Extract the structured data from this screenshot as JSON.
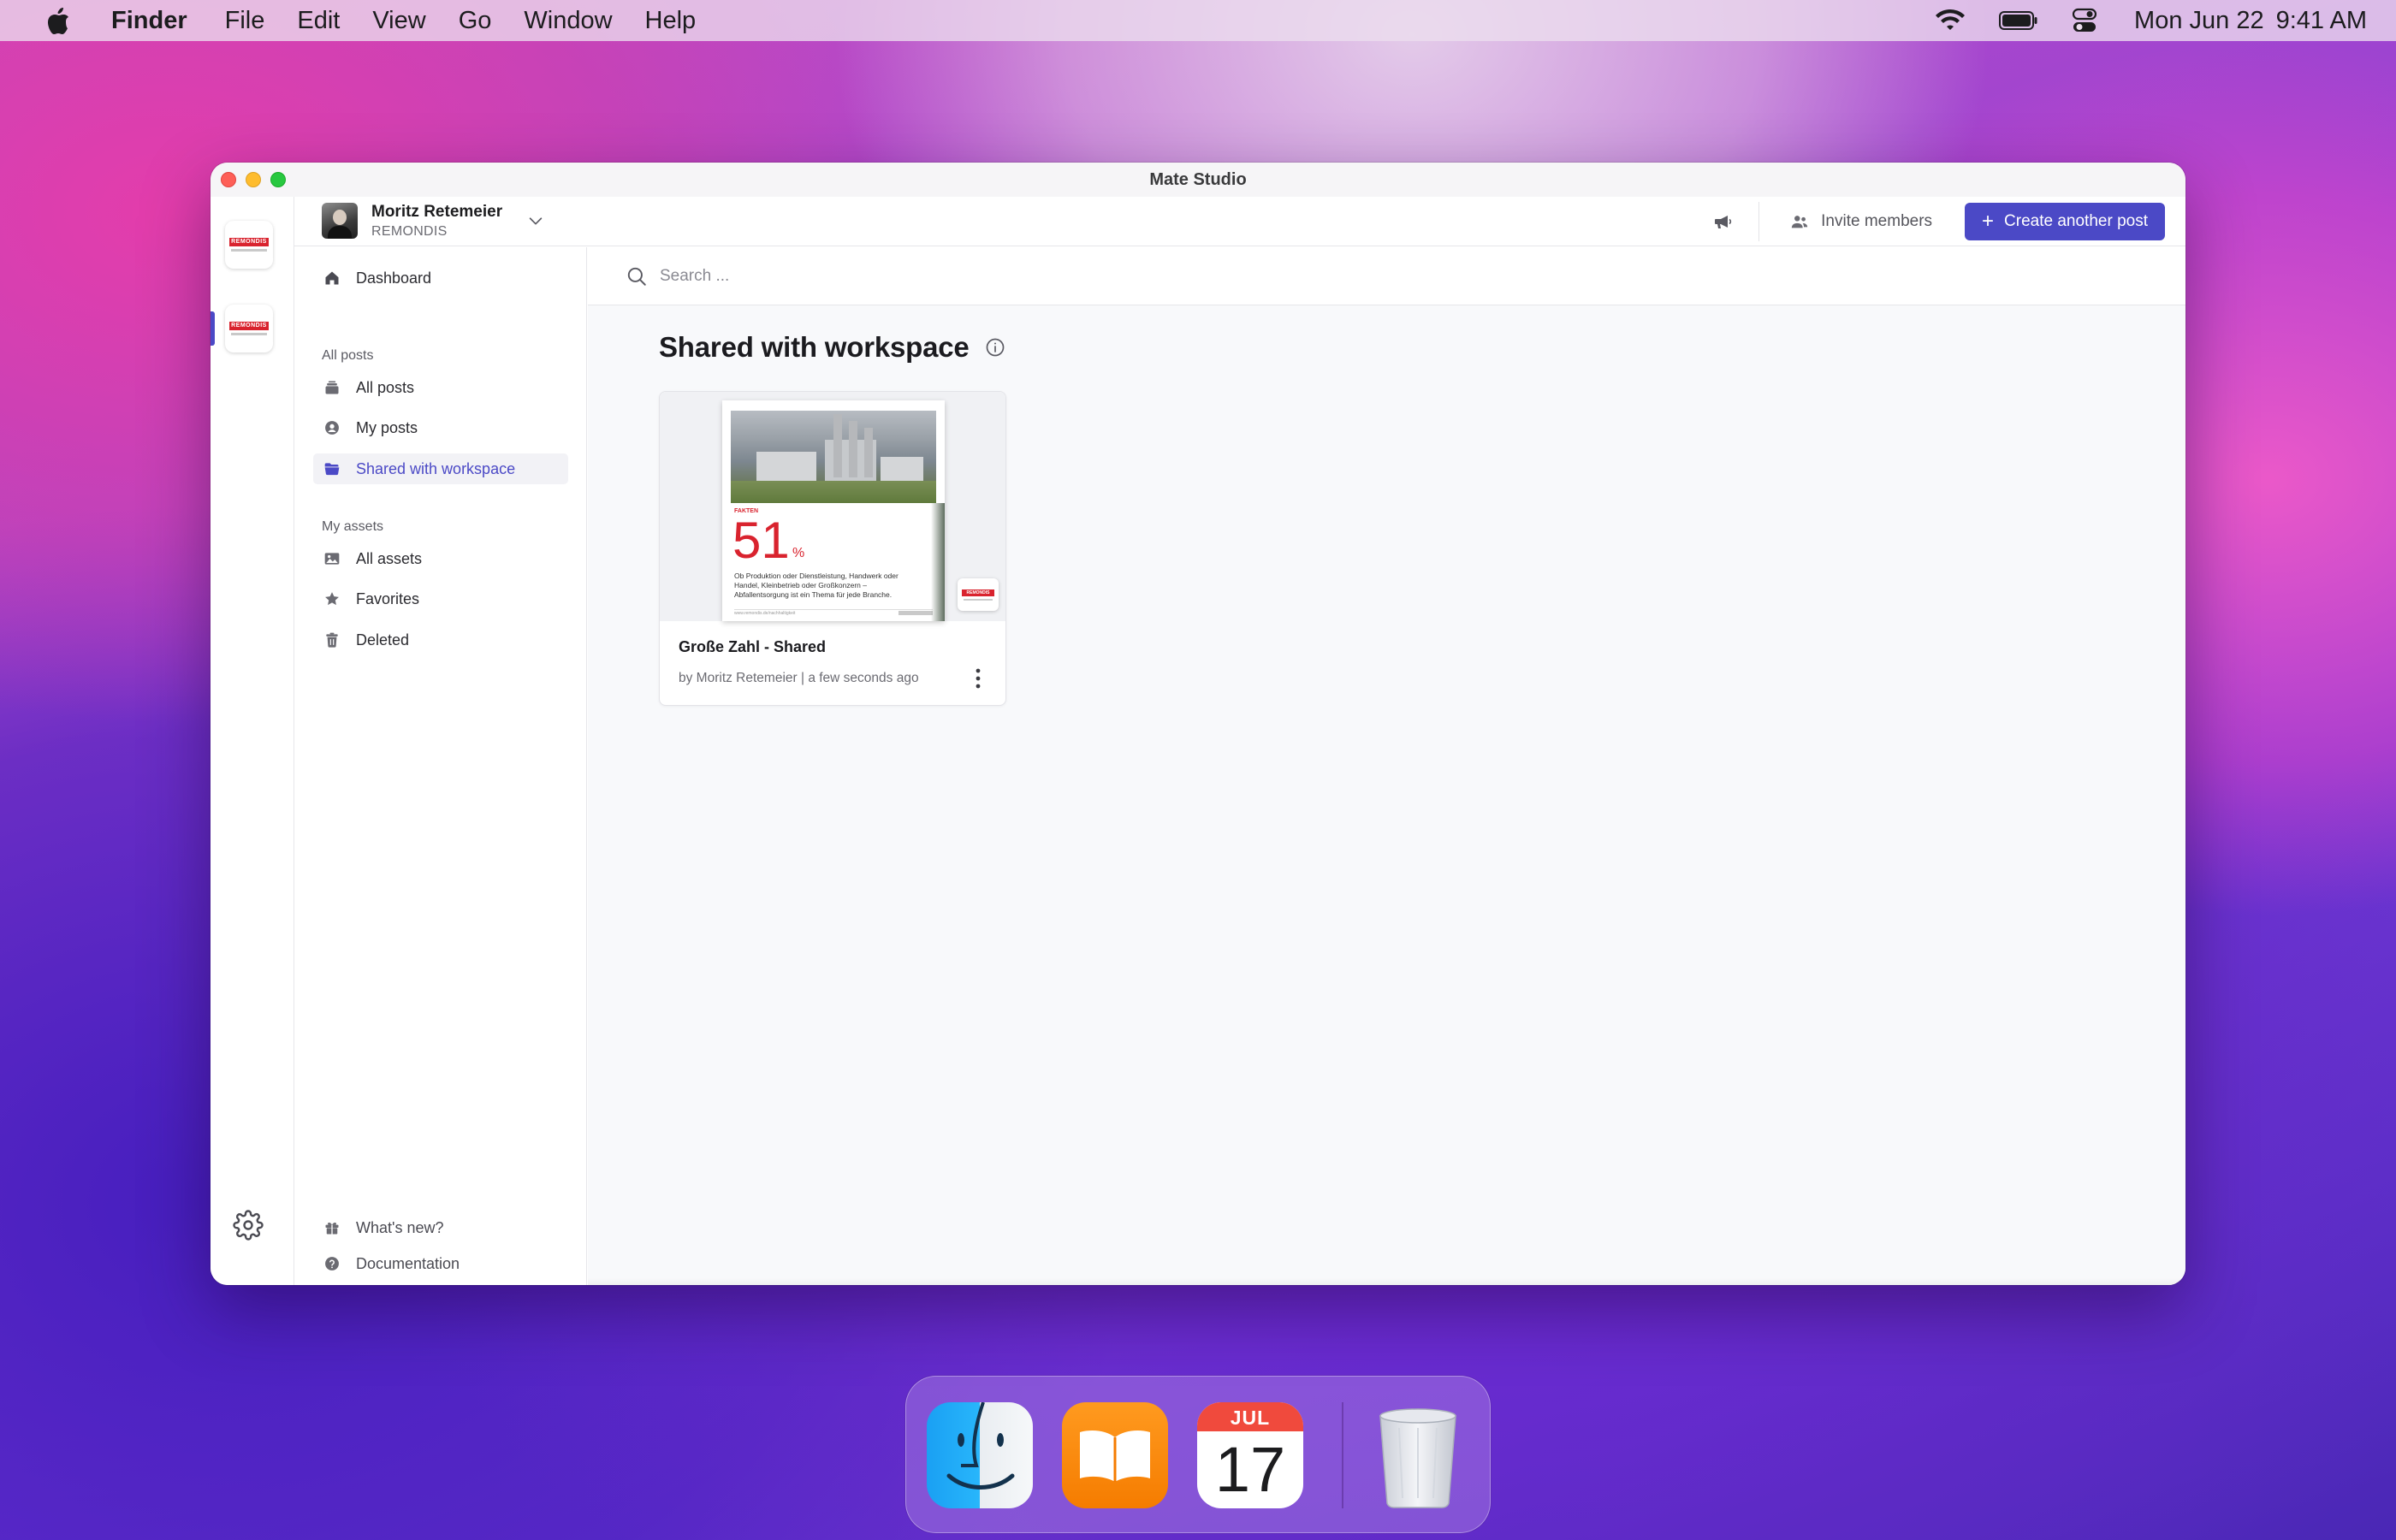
{
  "menubar": {
    "app_name": "Finder",
    "items": [
      "File",
      "Edit",
      "View",
      "Go",
      "Window",
      "Help"
    ],
    "date": "Mon Jun 22",
    "time": "9:41 AM",
    "icons": [
      "apple-icon",
      "wifi-icon",
      "battery-icon",
      "control-center-icon"
    ]
  },
  "window": {
    "title": "Mate Studio"
  },
  "rail": {
    "workspaces": [
      {
        "logo_text": "REMONDIS"
      },
      {
        "logo_text": "REMONDIS"
      }
    ]
  },
  "header": {
    "user_name": "Moritz Retemeier",
    "org_name": "REMONDIS",
    "invite_label": "Invite members",
    "create_label": "Create another post"
  },
  "nav": {
    "dashboard": "Dashboard",
    "posts_section": "All posts",
    "posts_items": [
      "All posts",
      "My posts",
      "Shared with workspace"
    ],
    "assets_section": "My assets",
    "assets_items": [
      "All assets",
      "Favorites",
      "Deleted"
    ],
    "whats_new": "What's new?",
    "documentation": "Documentation",
    "active": "Shared with workspace"
  },
  "main": {
    "search_placeholder": "Search ...",
    "page_title": "Shared with workspace",
    "cards": [
      {
        "title": "Große Zahl - Shared",
        "meta": "by Moritz Retemeier | a few seconds ago",
        "preview": {
          "label": "FAKTEN",
          "number": "51",
          "unit": "%",
          "text": "Ob Produktion oder Dienstleistung, Handwerk oder Handel, Kleinbetrieb oder Großkonzern – Abfallentsorgung ist ein Thema für jede Branche.",
          "footer_url": "www.remondis.de/nachhaltigkeit",
          "badge_text": "REMONDIS"
        }
      }
    ]
  },
  "dock": {
    "apps": [
      "Finder",
      "Books",
      "Calendar",
      "Trash"
    ],
    "calendar_month": "JUL",
    "calendar_day": "17"
  },
  "colors": {
    "accent": "#4b49c6",
    "brand_red": "#d9232e"
  }
}
